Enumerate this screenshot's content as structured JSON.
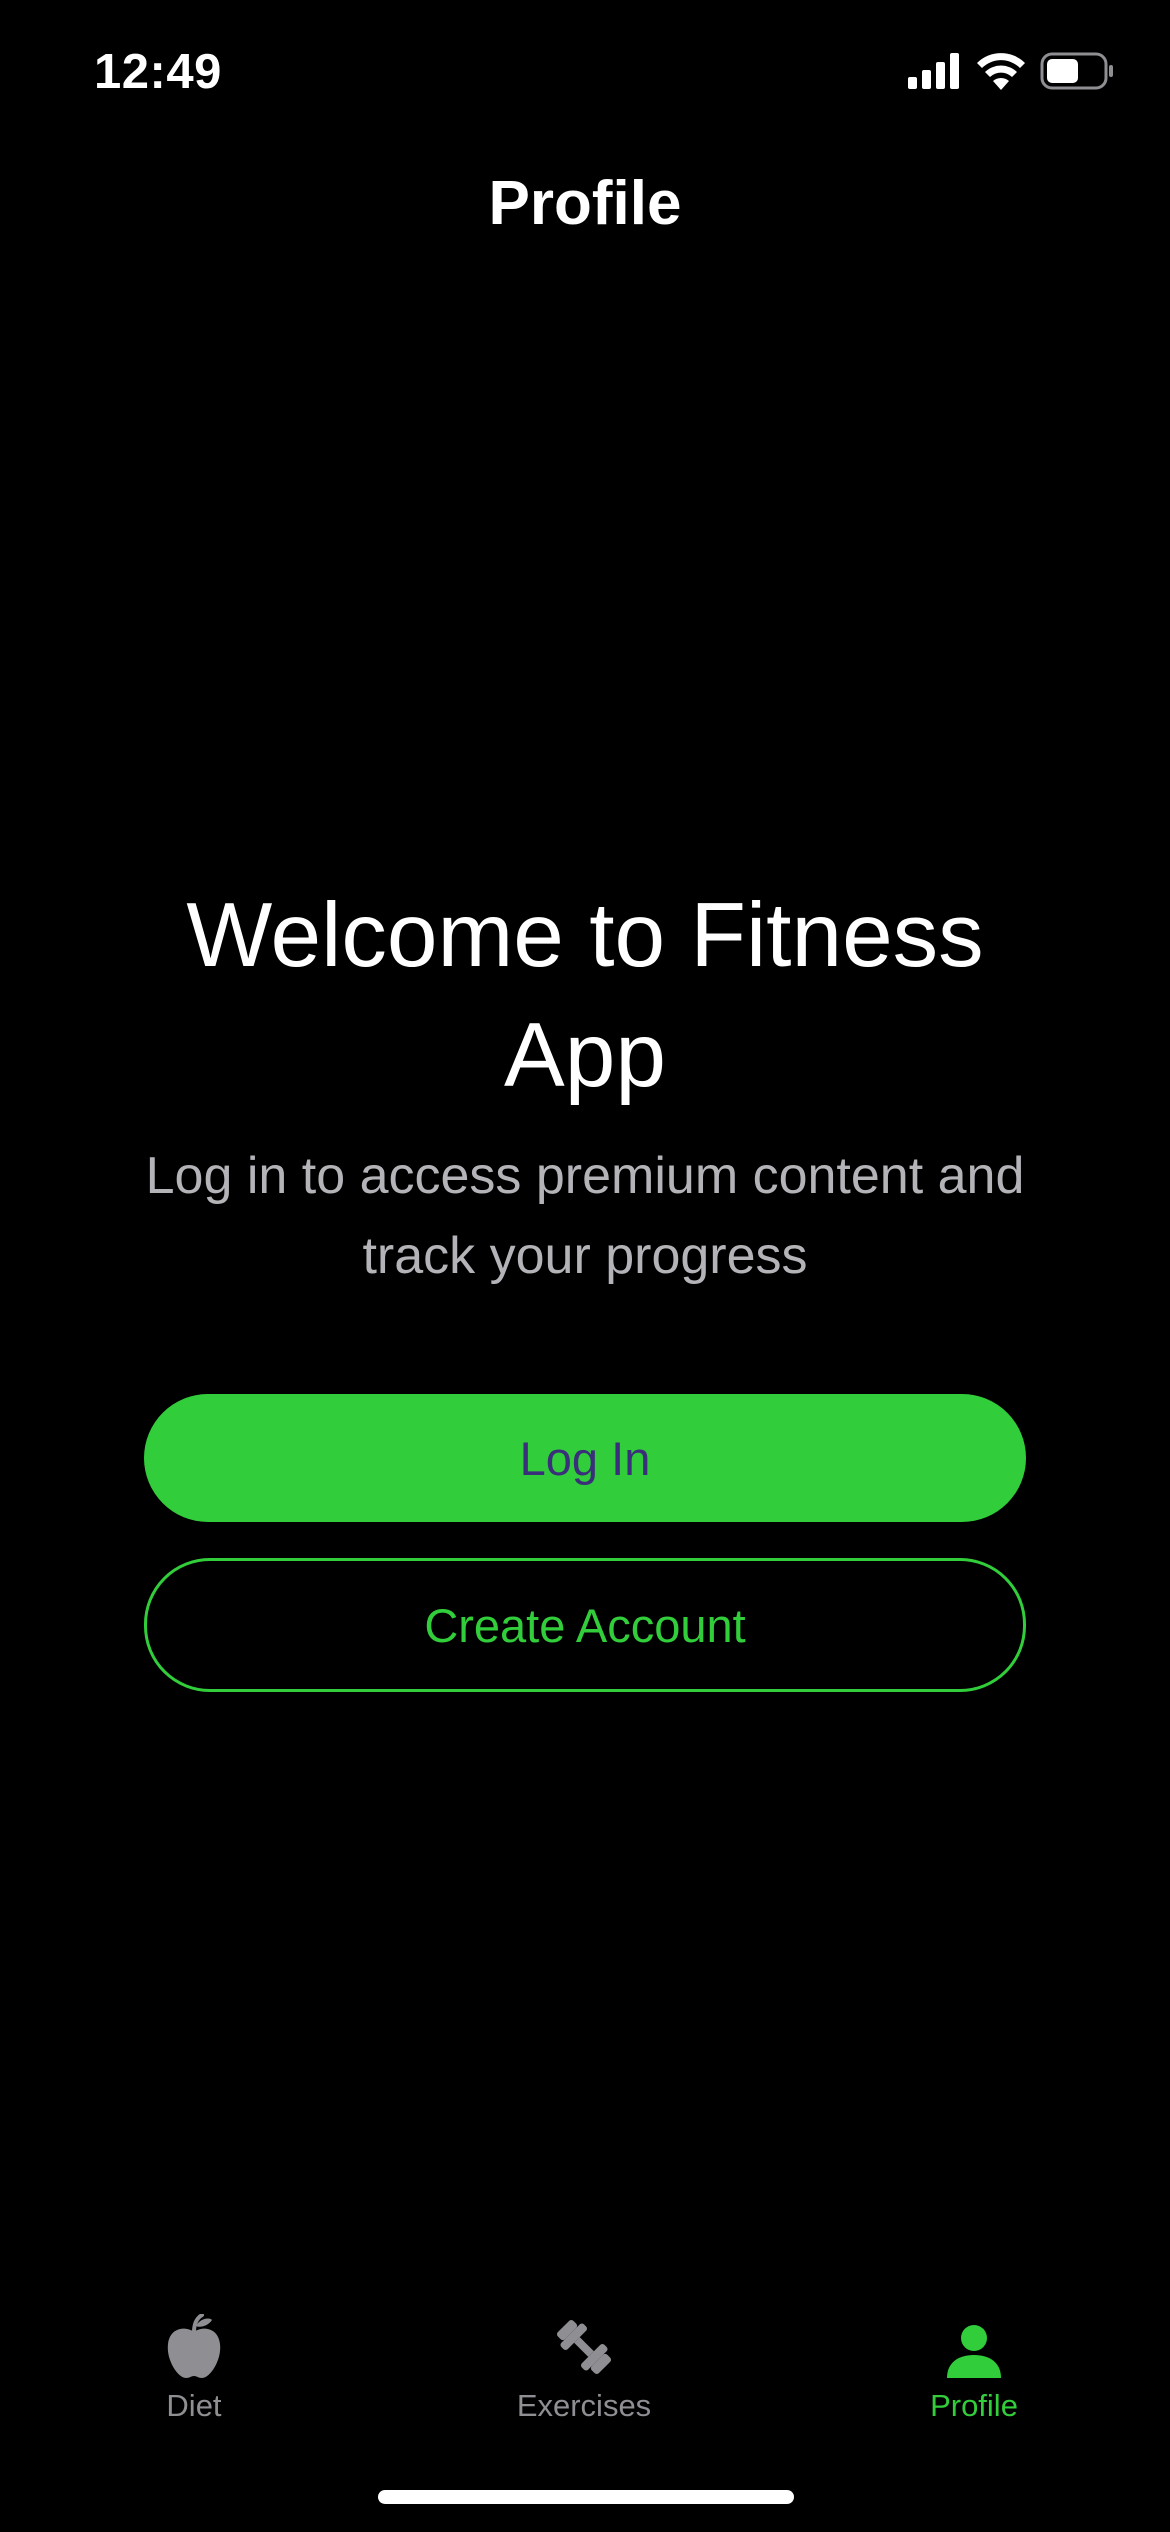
{
  "status_bar": {
    "time": "12:49",
    "signal_icon": "cellular-signal-icon",
    "wifi_icon": "wifi-icon",
    "battery_icon": "battery-icon",
    "battery_level": 0.55
  },
  "nav": {
    "title": "Profile"
  },
  "welcome": {
    "title": "Welcome to Fitness App",
    "subtitle": "Log in to access premium content and track your progress"
  },
  "actions": {
    "login_label": "Log In",
    "create_account_label": "Create Account"
  },
  "tab_bar": {
    "tabs": [
      {
        "label": "Diet",
        "icon": "apple-icon",
        "selected": false
      },
      {
        "label": "Exercises",
        "icon": "dumbbell-icon",
        "selected": false
      },
      {
        "label": "Profile",
        "icon": "person-icon",
        "selected": true
      }
    ]
  },
  "colors": {
    "accent": "#32cd3a",
    "login_text": "#3a2f7a",
    "inactive_tab": "#8e8e93",
    "subtitle": "#b3b3b8",
    "background": "#000000"
  }
}
